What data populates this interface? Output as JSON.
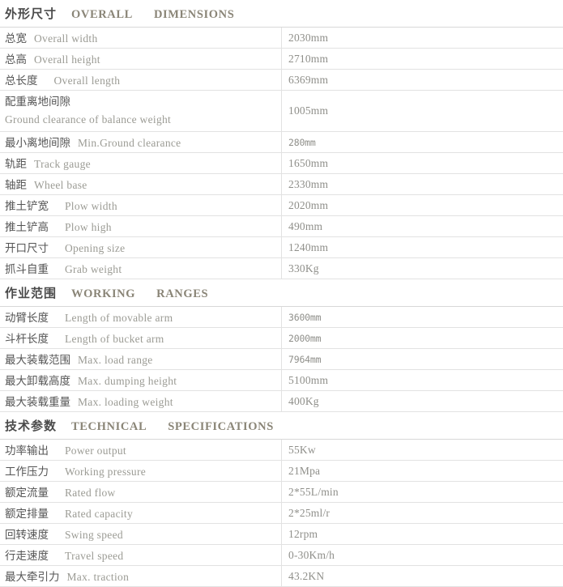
{
  "table": {
    "sections": [
      {
        "header": {
          "cn": "外形尺寸",
          "en1": "OVERALL",
          "en2": "DIMENSIONS"
        },
        "rows": [
          {
            "cn": "总宽",
            "en": "Overall   width",
            "value": "2030mm",
            "style": "normal"
          },
          {
            "cn": "总高",
            "en": "Overall   height",
            "value": "2710mm",
            "style": "normal"
          },
          {
            "cn": "总长度",
            "en": "Overall   length",
            "value": "6369mm",
            "style": "normal"
          },
          {
            "cn": "配重离地间隙",
            "en": "Ground   clearance   of   balance   weight",
            "value": "1005mm",
            "style": "two-line"
          },
          {
            "cn": "最小离地间隙",
            "en": "Min.Ground   clearance",
            "value": "280mm",
            "style": "narrow"
          },
          {
            "cn": "轨距",
            "en": "Track   gauge",
            "value": "1650mm",
            "style": "normal"
          },
          {
            "cn": "轴距",
            "en": "Wheel   base",
            "value": "2330mm",
            "style": "normal"
          },
          {
            "cn": "推土铲宽",
            "en": "Plow   width",
            "value": "2020mm",
            "style": "normal"
          },
          {
            "cn": "推土铲高",
            "en": "Plow   high",
            "value": "490mm",
            "style": "normal"
          },
          {
            "cn": "开口尺寸",
            "en": "Opening   size",
            "value": "1240mm",
            "style": "normal"
          },
          {
            "cn": "抓斗自重",
            "en": "Grab   weight",
            "value": "330Kg",
            "style": "normal"
          }
        ]
      },
      {
        "header": {
          "cn": "作业范围",
          "en1": "WORKING",
          "en2": "RANGES"
        },
        "rows": [
          {
            "cn": "动臂长度",
            "en": "Length   of   movable   arm",
            "value": "3600mm",
            "style": "narrow"
          },
          {
            "cn": "斗杆长度",
            "en": "Length   of   bucket   arm",
            "value": "2000mm",
            "style": "narrow"
          },
          {
            "cn": "最大装载范围",
            "en": "Max.   load   range",
            "value": "7964mm",
            "style": "narrow"
          },
          {
            "cn": "最大卸载高度",
            "en": "Max.   dumping   height",
            "value": "5100mm",
            "style": "normal"
          },
          {
            "cn": "最大装载重量",
            "en": "Max.   loading   weight",
            "value": "400Kg",
            "style": "normal"
          }
        ]
      },
      {
        "header": {
          "cn": "技术参数",
          "en1": "TECHNICAL",
          "en2": "SPECIFICATIONS"
        },
        "rows": [
          {
            "cn": "功率输出",
            "en": "Power   output",
            "value": "55Kw",
            "style": "normal"
          },
          {
            "cn": "工作压力",
            "en": "Working   pressure",
            "value": "21Mpa",
            "style": "normal"
          },
          {
            "cn": "额定流量",
            "en": "Rated   flow",
            "value": "2*55L/min",
            "style": "normal"
          },
          {
            "cn": "额定排量",
            "en": "Rated   capacity",
            "value": "2*25ml/r",
            "style": "normal"
          },
          {
            "cn": "回转速度",
            "en": "Swing   speed",
            "value": "12rpm",
            "style": "normal"
          },
          {
            "cn": "行走速度",
            "en": "Travel   speed",
            "value": "0-30Km/h",
            "style": "normal"
          },
          {
            "cn": "最大牵引力",
            "en": "Max.   traction",
            "value": "43.2KN",
            "style": "normal"
          }
        ]
      }
    ]
  },
  "colors": {
    "border": "#e2e2e2",
    "label_cn": "#555555",
    "label_en": "#9b9b94",
    "value": "#8f8f8a",
    "section_cn": "#4a4a4a",
    "section_en": "#8a8577"
  }
}
